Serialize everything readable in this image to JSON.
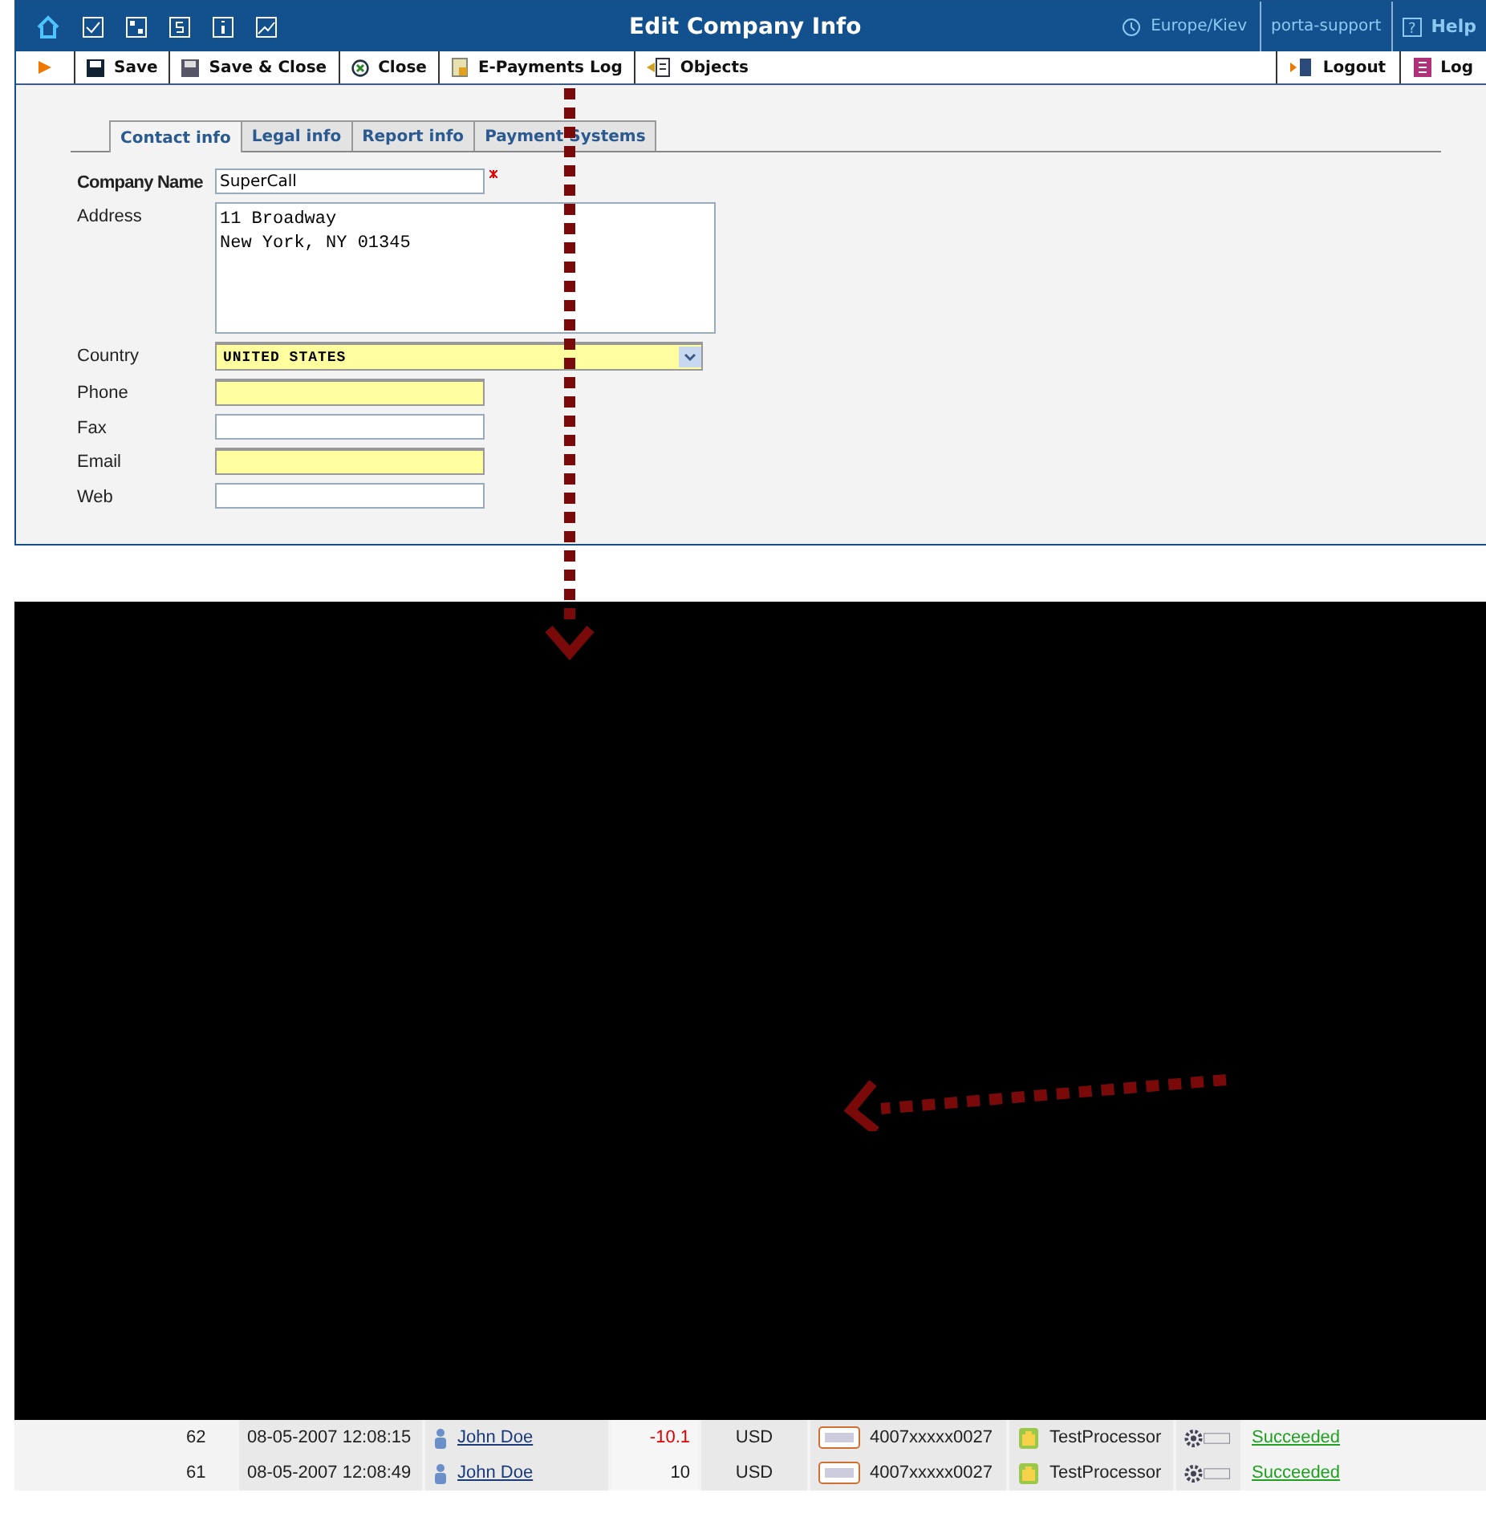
{
  "window": {
    "title": "Edit Company Info",
    "timezone": "Europe/Kiev",
    "user": "porta-support",
    "help": "Help",
    "help_icon": "?"
  },
  "toolbar": {
    "buttons": [
      {
        "kind": "save",
        "label": "Save"
      },
      {
        "kind": "save-close",
        "label": "Save & Close"
      },
      {
        "kind": "close",
        "label": "Close"
      },
      {
        "kind": "log",
        "label": "E-Payments Log"
      },
      {
        "kind": "objects",
        "label": "Objects"
      }
    ],
    "right_buttons": [
      {
        "kind": "logout",
        "label": "Logout"
      },
      {
        "kind": "book",
        "label": "Log"
      }
    ]
  },
  "tabs": [
    {
      "label": "Contact info",
      "selected": true
    },
    {
      "label": "Legal info",
      "selected": false
    },
    {
      "label": "Report info",
      "selected": false
    },
    {
      "label": "Payment Systems",
      "selected": false
    }
  ],
  "form": {
    "fields": [
      {
        "kind": "text",
        "label": "Company Name",
        "value": "SuperCall",
        "required": true,
        "highlighted": false
      },
      {
        "kind": "textarea",
        "label": "Address",
        "lines": [
          "11 Broadway",
          "New York, NY 01345"
        ],
        "required": false,
        "highlighted": false
      },
      {
        "kind": "select",
        "label": "Country",
        "value": "UNITED STATES",
        "required": false,
        "highlighted": true
      },
      {
        "kind": "text",
        "label": "Phone",
        "required": false,
        "highlighted": true
      },
      {
        "kind": "text",
        "label": "Fax",
        "required": false,
        "highlighted": false
      },
      {
        "kind": "text",
        "label": "Email",
        "required": false,
        "highlighted": true
      },
      {
        "kind": "text",
        "label": "Web",
        "required": false,
        "highlighted": false
      }
    ]
  },
  "log_rows": [
    {
      "id": "62",
      "time": "08-05-2007 12:08:15",
      "user": "John Doe",
      "amount": "-10.1",
      "negative": true,
      "currency": "USD",
      "card": "4007xxxxx0027",
      "processor": "TestProcessor",
      "status": "Succeeded"
    },
    {
      "id": "61",
      "time": "08-05-2007 12:08:49",
      "user": "John Doe",
      "amount": "10",
      "negative": false,
      "currency": "USD",
      "card": "4007xxxxx0027",
      "processor": "TestProcessor",
      "status": "Succeeded"
    }
  ]
}
